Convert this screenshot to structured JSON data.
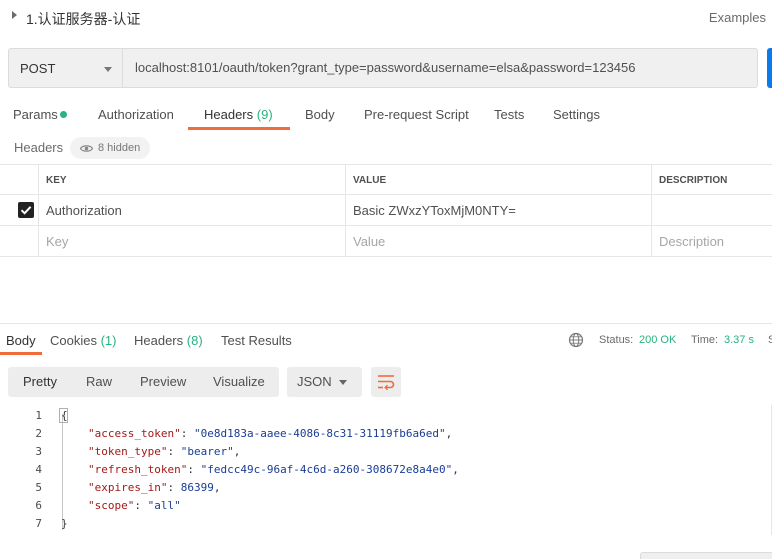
{
  "title_bar": {
    "title": "1.认证服务器-认证",
    "examples_label": "Examples"
  },
  "request": {
    "method": "POST",
    "url": "localhost:8101/oauth/token?grant_type=password&username=elsa&password=123456"
  },
  "request_tabs": {
    "params": "Params",
    "authorization": "Authorization",
    "headers": "Headers",
    "headers_count": "(9)",
    "body": "Body",
    "prerequest": "Pre-request Script",
    "tests": "Tests",
    "settings": "Settings"
  },
  "headers_section": {
    "title": "Headers",
    "hidden_label": "8 hidden"
  },
  "headers_table": {
    "columns": [
      "KEY",
      "VALUE",
      "DESCRIPTION"
    ],
    "rows": [
      {
        "key": "Authorization",
        "value": "Basic ZWxzYToxMjM0NTY=",
        "description": ""
      }
    ],
    "placeholder": {
      "key": "Key",
      "value": "Value",
      "description": "Description"
    }
  },
  "response_tabs": {
    "body": "Body",
    "cookies": "Cookies",
    "cookies_count": "(1)",
    "headers": "Headers",
    "headers_count": "(8)",
    "test_results": "Test Results"
  },
  "response_status": {
    "status_label": "Status:",
    "status_value": "200 OK",
    "time_label": "Time:",
    "time_value": "3.37 s",
    "size_clip": "S"
  },
  "response_toolbar": {
    "formats": [
      "Pretty",
      "Raw",
      "Preview",
      "Visualize"
    ],
    "language": "JSON"
  },
  "response_body": {
    "lines": [
      "1",
      "2",
      "3",
      "4",
      "5",
      "6",
      "7"
    ],
    "open_brace": "{",
    "close_brace": "}",
    "fields": [
      {
        "key": "\"access_token\"",
        "value": "\"0e8d183a-aaee-4086-8c31-31119fb6a6ed\"",
        "sep": ","
      },
      {
        "key": "\"token_type\"",
        "value": "\"bearer\"",
        "sep": ","
      },
      {
        "key": "\"refresh_token\"",
        "value": "\"fedcc49c-96af-4c6d-a260-308672e8a4e0\"",
        "sep": ","
      },
      {
        "key": "\"expires_in\"",
        "value": "86399",
        "sep": ","
      },
      {
        "key": "\"scope\"",
        "value": "\"all\"",
        "sep": ""
      }
    ]
  },
  "colors": {
    "accent_orange": "#f26b3a",
    "success_green": "#26b47f",
    "send_blue": "#097bed"
  }
}
